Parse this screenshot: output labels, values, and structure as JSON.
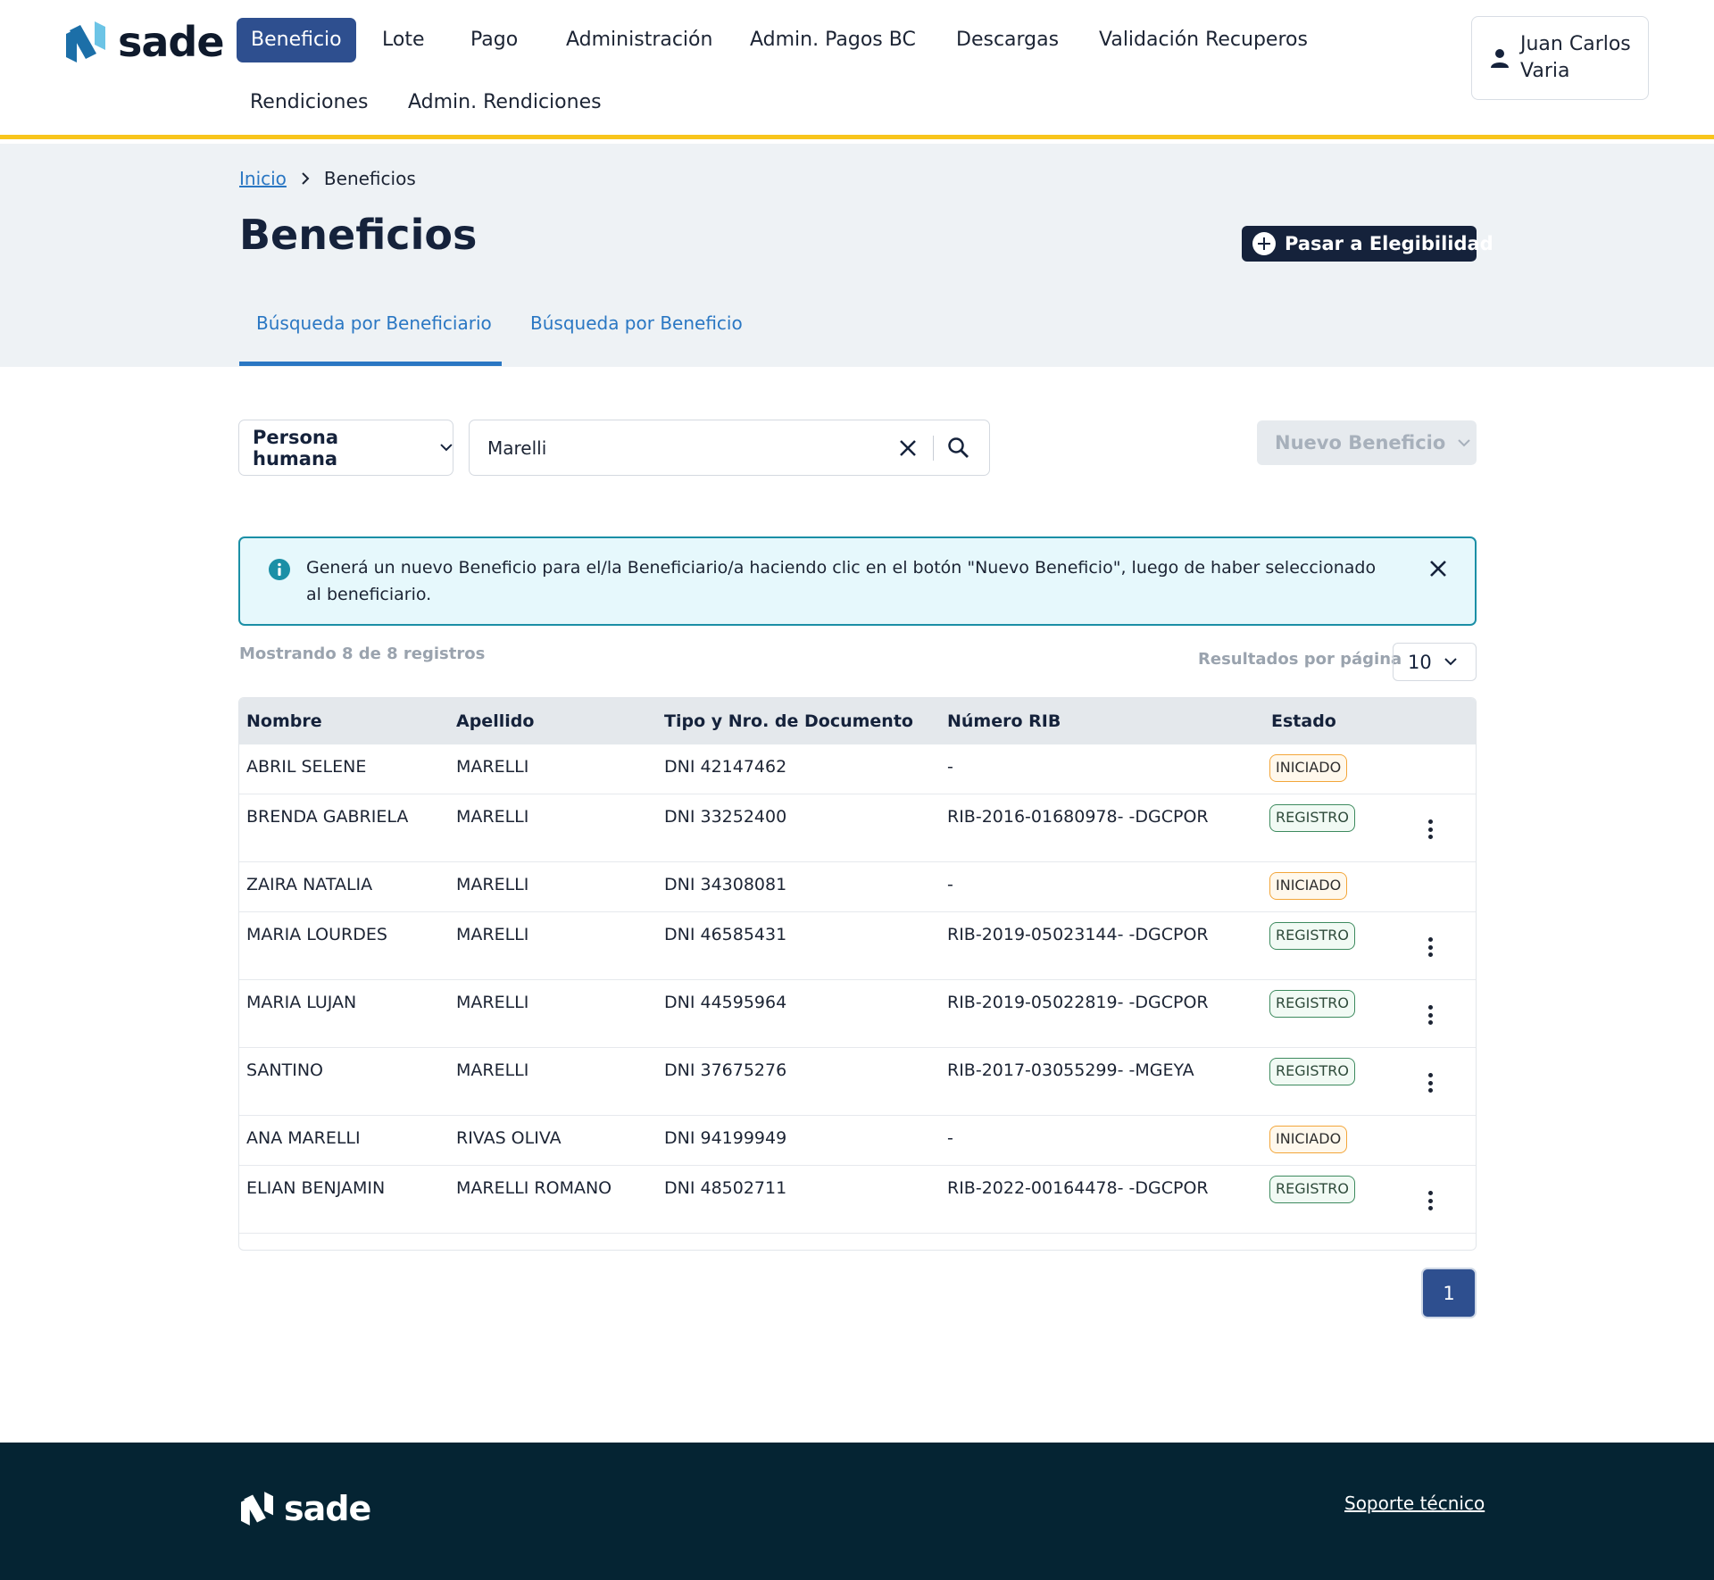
{
  "header": {
    "logo_text": "sade",
    "nav": [
      "Beneficio",
      "Lote",
      "Pago",
      "Administración",
      "Admin. Pagos BC",
      "Descargas",
      "Validación Recuperos",
      "Rendiciones",
      "Admin. Rendiciones"
    ],
    "active_nav": "Beneficio",
    "user_name": "Juan Carlos Varia",
    "accent_color": "#f8c51c",
    "brand_color": "#2e4f8f"
  },
  "breadcrumb": {
    "home": "Inicio",
    "current": "Beneficios"
  },
  "page": {
    "title": "Beneficios",
    "eligibility_button": "Pasar a Elegibilidad",
    "tabs": [
      "Búsqueda por Beneficiario",
      "Búsqueda por Beneficio"
    ],
    "active_tab": "Búsqueda por Beneficiario"
  },
  "search": {
    "type_selected": "Persona humana",
    "value": "Marelli",
    "new_button": "Nuevo Beneficio"
  },
  "alert": {
    "text": "Generá un nuevo Beneficio para el/la Beneficiario/a haciendo clic en el botón \"Nuevo Beneficio\", luego de haber seleccionado al beneficiario."
  },
  "results": {
    "count_text": "Mostrando 8 de 8 registros",
    "per_page_label": "Resultados por página",
    "per_page_value": "10"
  },
  "table": {
    "headers": [
      "Nombre",
      "Apellido",
      "Tipo y Nro. de Documento",
      "Número RIB",
      "Estado"
    ],
    "rows": [
      {
        "nombre": "ABRIL SELENE",
        "apellido": "MARELLI",
        "documento": "DNI 42147462",
        "rib": "-",
        "estado": "INICIADO"
      },
      {
        "nombre": "BRENDA GABRIELA",
        "apellido": "MARELLI",
        "documento": "DNI 33252400",
        "rib": "RIB-2016-01680978- -DGCPOR",
        "estado": "REGISTRO"
      },
      {
        "nombre": "ZAIRA NATALIA",
        "apellido": "MARELLI",
        "documento": "DNI 34308081",
        "rib": "-",
        "estado": "INICIADO"
      },
      {
        "nombre": "MARIA LOURDES",
        "apellido": "MARELLI",
        "documento": "DNI 46585431",
        "rib": "RIB-2019-05023144- -DGCPOR",
        "estado": "REGISTRO"
      },
      {
        "nombre": "MARIA LUJAN",
        "apellido": "MARELLI",
        "documento": "DNI 44595964",
        "rib": "RIB-2019-05022819- -DGCPOR",
        "estado": "REGISTRO"
      },
      {
        "nombre": "SANTINO",
        "apellido": "MARELLI",
        "documento": "DNI 37675276",
        "rib": "RIB-2017-03055299- -MGEYA",
        "estado": "REGISTRO"
      },
      {
        "nombre": "ANA MARELLI",
        "apellido": "RIVAS OLIVA",
        "documento": "DNI 94199949",
        "rib": "-",
        "estado": "INICIADO"
      },
      {
        "nombre": "ELIAN BENJAMIN",
        "apellido": "MARELLI ROMANO",
        "documento": "DNI 48502711",
        "rib": "RIB-2022-00164478- -DGCPOR",
        "estado": "REGISTRO"
      }
    ]
  },
  "pagination": {
    "current": "1"
  },
  "footer": {
    "logo_text": "sade",
    "support_link": "Soporte técnico"
  }
}
